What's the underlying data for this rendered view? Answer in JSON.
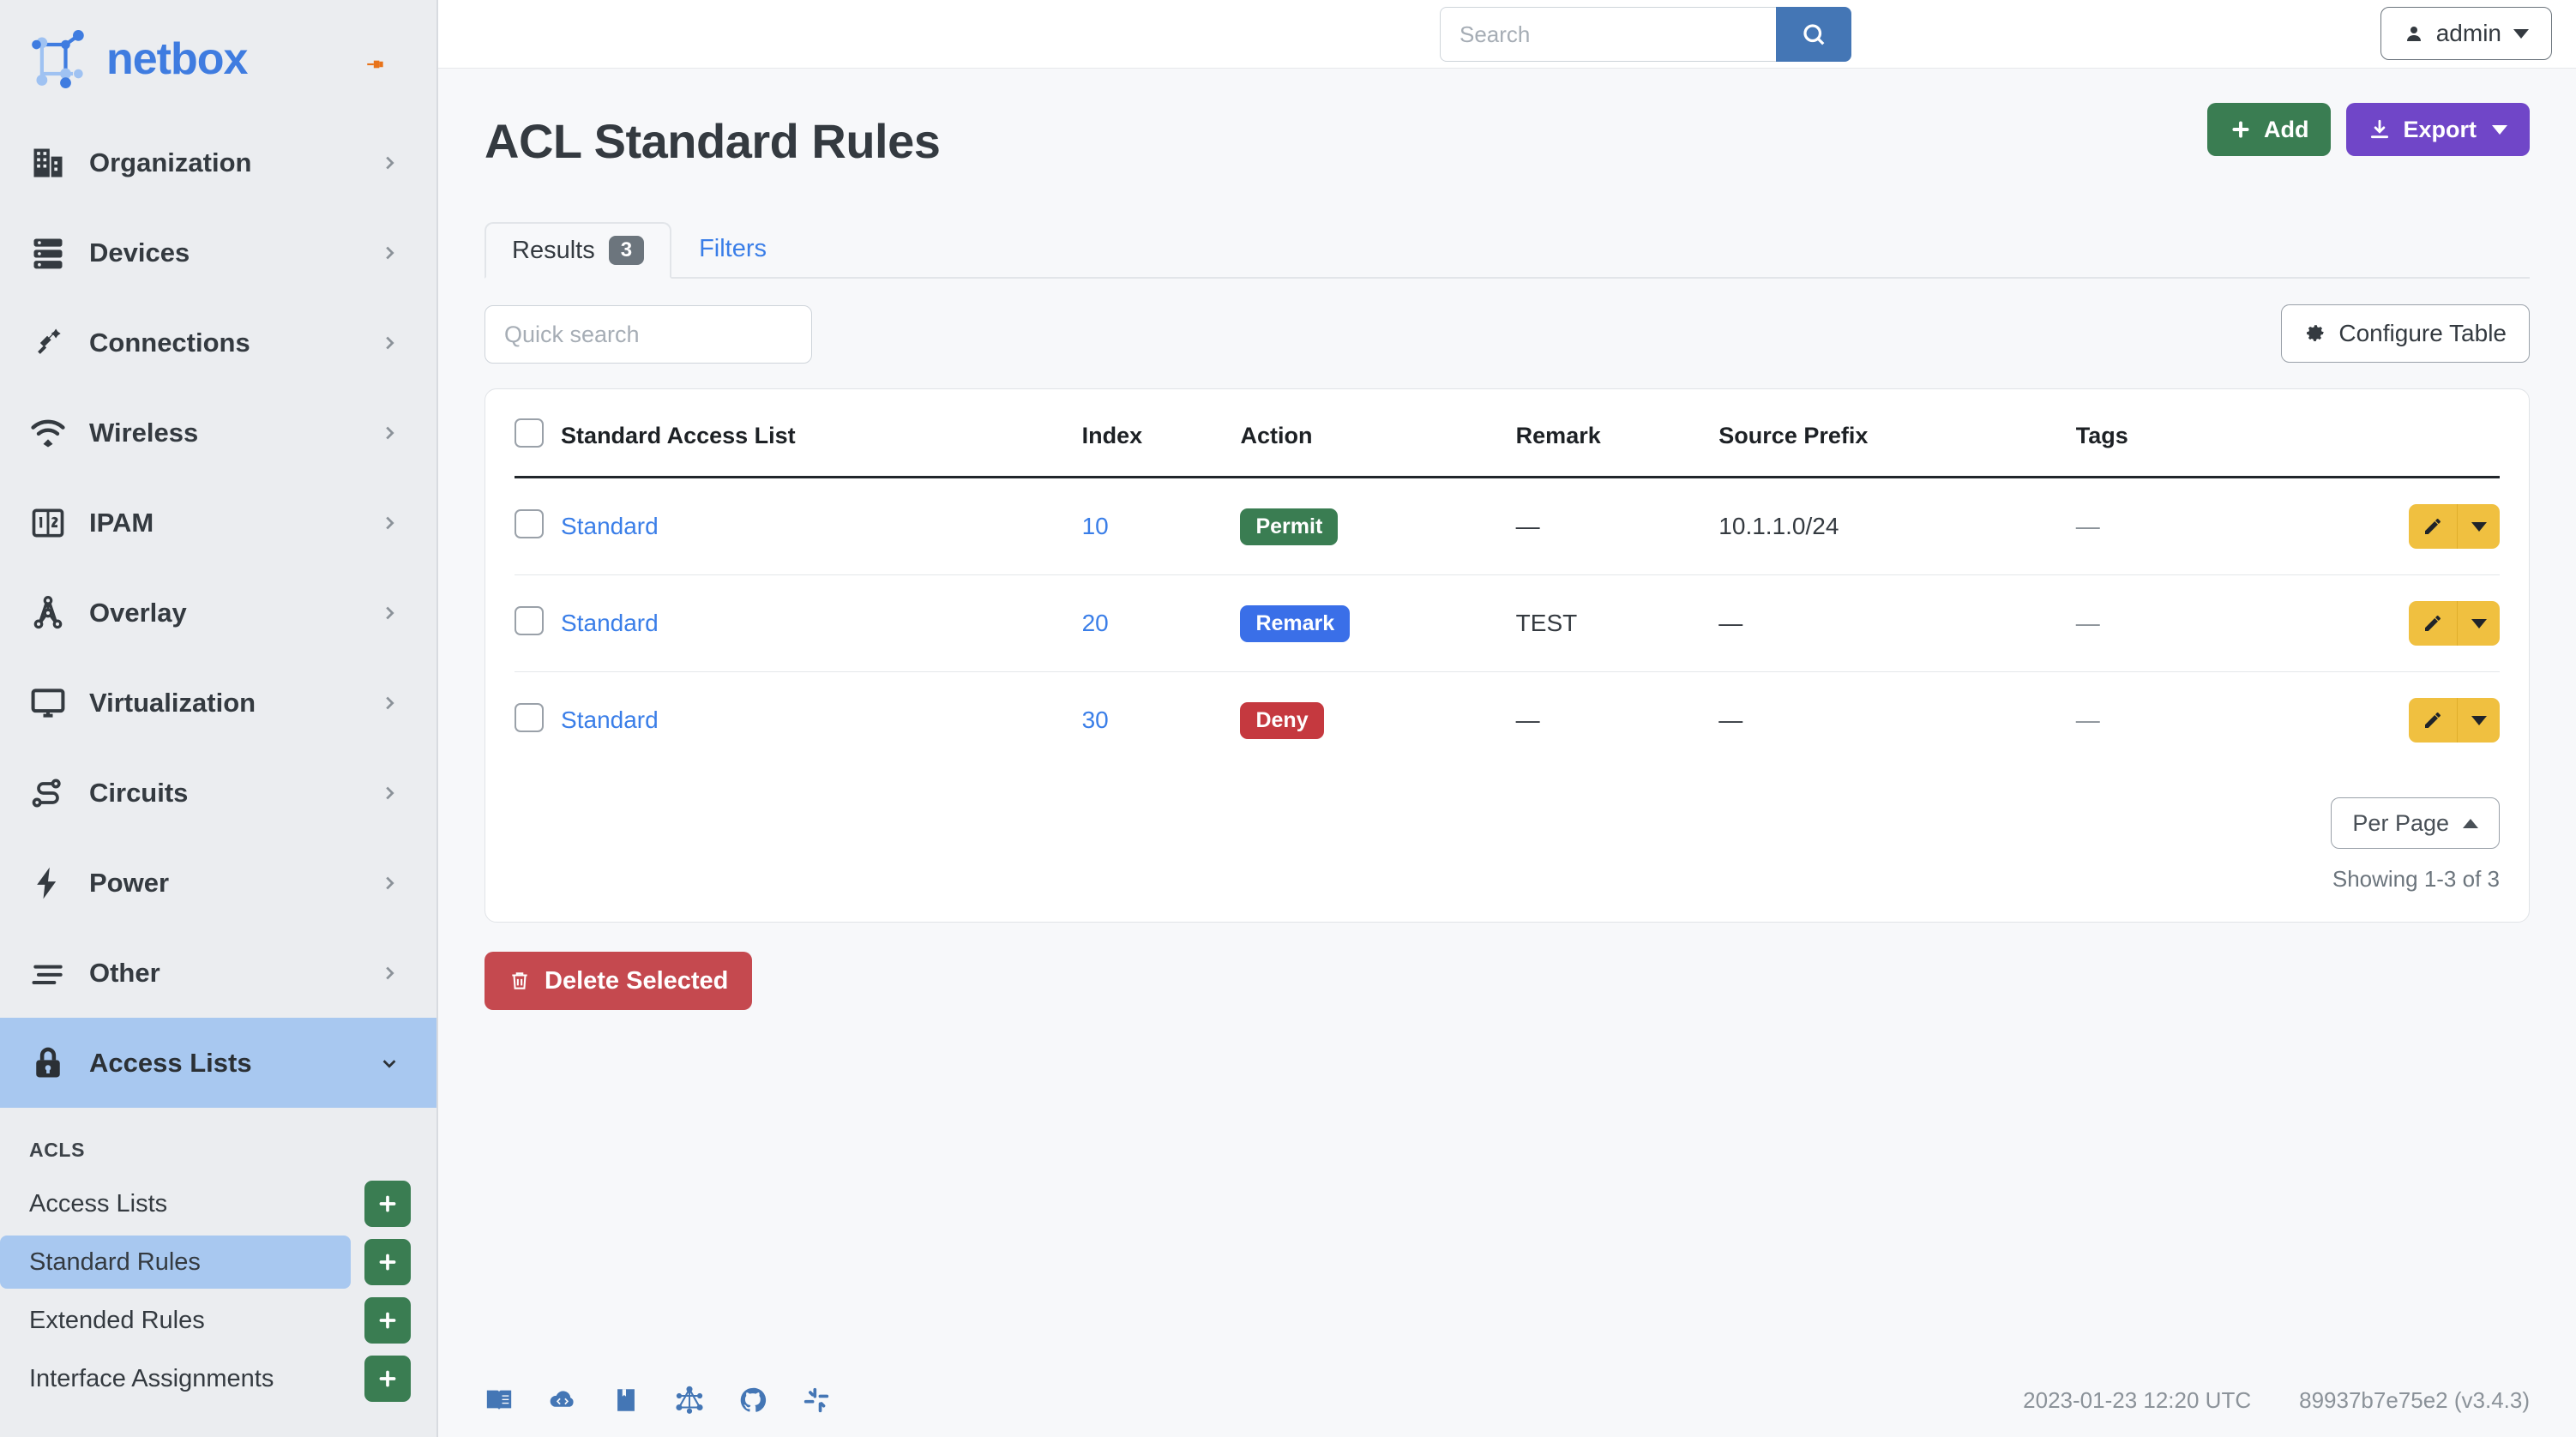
{
  "brand": {
    "name": "netbox",
    "pin_icon": "pin-icon"
  },
  "topbar": {
    "search": {
      "placeholder": "Search",
      "value": "",
      "button_icon": "search-icon"
    },
    "user": {
      "label": "admin",
      "icon": "user-icon"
    }
  },
  "sidebar": {
    "items": [
      {
        "label": "Organization",
        "icon": "building-icon",
        "state": "collapsed"
      },
      {
        "label": "Devices",
        "icon": "server-icon",
        "state": "collapsed"
      },
      {
        "label": "Connections",
        "icon": "plug-icon",
        "state": "collapsed"
      },
      {
        "label": "Wireless",
        "icon": "wifi-icon",
        "state": "collapsed"
      },
      {
        "label": "IPAM",
        "icon": "numbers-icon",
        "state": "collapsed"
      },
      {
        "label": "Overlay",
        "icon": "hierarchy-icon",
        "state": "collapsed"
      },
      {
        "label": "Virtualization",
        "icon": "monitor-icon",
        "state": "collapsed"
      },
      {
        "label": "Circuits",
        "icon": "circuit-icon",
        "state": "collapsed"
      },
      {
        "label": "Power",
        "icon": "bolt-icon",
        "state": "collapsed"
      },
      {
        "label": "Other",
        "icon": "lines-icon",
        "state": "collapsed"
      },
      {
        "label": "Access Lists",
        "icon": "lock-icon",
        "state": "expanded"
      }
    ],
    "submenu": {
      "title": "ACLS",
      "items": [
        {
          "label": "Access Lists",
          "active": false,
          "add_icon": "plus-icon"
        },
        {
          "label": "Standard Rules",
          "active": true,
          "add_icon": "plus-icon"
        },
        {
          "label": "Extended Rules",
          "active": false,
          "add_icon": "plus-icon"
        },
        {
          "label": "Interface Assignments",
          "active": false,
          "add_icon": "plus-icon"
        }
      ]
    }
  },
  "page": {
    "title": "ACL Standard Rules",
    "add_label": "Add",
    "export_label": "Export"
  },
  "tabs": [
    {
      "label": "Results",
      "badge": "3",
      "active": true
    },
    {
      "label": "Filters",
      "badge": "",
      "active": false
    }
  ],
  "toolbar": {
    "quick_search_placeholder": "Quick search",
    "quick_search_value": "",
    "configure_table_label": "Configure Table"
  },
  "table": {
    "columns": [
      "Standard Access List",
      "Index",
      "Action",
      "Remark",
      "Source Prefix",
      "Tags"
    ],
    "rows": [
      {
        "name": "Standard",
        "index": "10",
        "action": "Permit",
        "action_color": "#3a7d52",
        "remark": "—",
        "source_prefix": "10.1.1.0/24",
        "tags": "—"
      },
      {
        "name": "Standard",
        "index": "20",
        "action": "Remark",
        "action_color": "#3a6fe8",
        "remark": "TEST",
        "source_prefix": "—",
        "tags": "—"
      },
      {
        "name": "Standard",
        "index": "30",
        "action": "Deny",
        "action_color": "#c5393f",
        "remark": "—",
        "source_prefix": "—",
        "tags": "—"
      }
    ],
    "per_page_label": "Per Page",
    "showing": "Showing 1-3 of 3"
  },
  "delete_selected_label": "Delete Selected",
  "footer": {
    "icons": [
      "docs-book-icon",
      "api-cloud-icon",
      "bookmark-icon",
      "graphql-icon",
      "github-icon",
      "slack-icon"
    ],
    "timestamp": "2023-01-23 12:20 UTC",
    "version": "89937b7e75e2 (v3.4.3)"
  },
  "colors": {
    "brand_blue": "#3f7ce0",
    "accent_green": "#3a7d52",
    "accent_purple": "#7046c8",
    "accent_red": "#c5494f",
    "accent_yellow": "#f0c040",
    "sidebar_bg": "#ebedf0",
    "active_nav": "#a8c8f0"
  }
}
